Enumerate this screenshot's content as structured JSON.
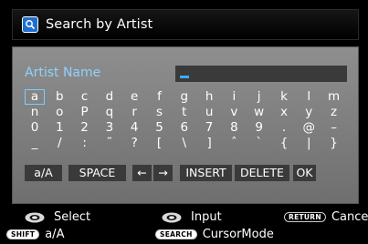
{
  "header": {
    "title": "Search by Artist",
    "icon": "search-icon"
  },
  "field": {
    "label": "Artist Name",
    "value": ""
  },
  "keyboard": {
    "rows": [
      [
        "a",
        "b",
        "c",
        "d",
        "e",
        "f",
        "g",
        "h",
        "i",
        "j",
        "k",
        "l",
        "m"
      ],
      [
        "n",
        "o",
        "P",
        "q",
        "r",
        "s",
        "t",
        "u",
        "v",
        "w",
        "x",
        "y",
        "z"
      ],
      [
        "0",
        "1",
        "2",
        "3",
        "4",
        "5",
        "6",
        "7",
        "8",
        "9",
        ".",
        "@",
        "–"
      ],
      [
        "_",
        "/",
        ":",
        "˜",
        "?",
        "[",
        "\\",
        "]",
        "ˆ",
        "`",
        "{",
        "|",
        "}"
      ]
    ],
    "selected": "a",
    "buttons": [
      "a/A",
      "SPACE",
      "←",
      "→",
      "INSERT",
      "DELETE",
      "OK"
    ]
  },
  "footer": {
    "select": "Select",
    "input": "Input",
    "cancel": "Cancel",
    "return_tag": "RETURN",
    "shift_tag": "SHIFT",
    "case": "a/A",
    "search_tag": "SEARCH",
    "cursor_mode": "CursorMode"
  },
  "colors": {
    "accent": "#76d0ff",
    "label": "#8fd1ff",
    "header_icon": "#1f6fcf"
  }
}
